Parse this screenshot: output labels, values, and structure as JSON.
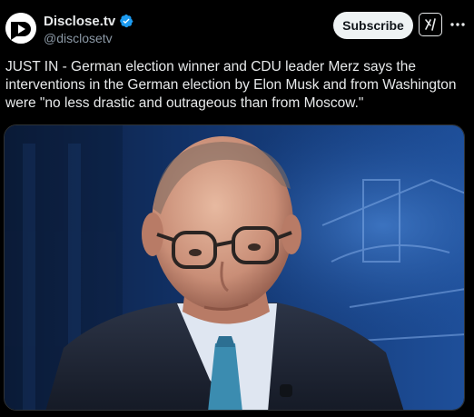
{
  "account": {
    "display_name": "Disclose.tv",
    "handle": "@disclosetv",
    "verified_icon": "verified-badge-icon"
  },
  "header": {
    "subscribe_label": "Subscribe",
    "grok_icon": "grok-icon",
    "more_icon": "more-dots-icon"
  },
  "tweet": {
    "text": "JUST IN - German election winner and CDU leader Merz says the interventions in the German election by Elon Musk and from Washington were \"no less drastic and outrageous than from Moscow.\""
  },
  "media": {
    "type": "photo"
  },
  "colors": {
    "background": "#000000",
    "text": "#e7e9ea",
    "secondary_text": "#8b98a5",
    "verified": "#1d9bf0",
    "button_bg": "#eff3f4"
  }
}
